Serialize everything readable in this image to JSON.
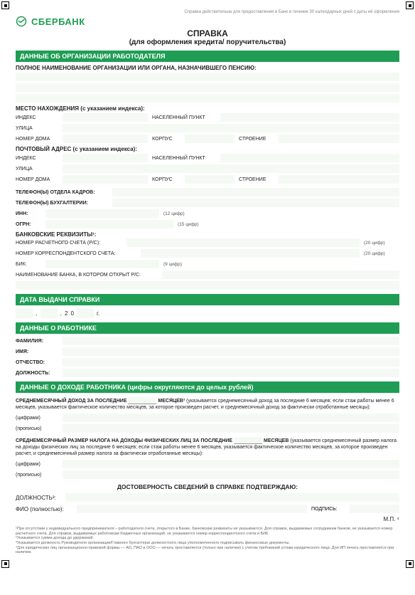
{
  "meta": {
    "top_note": "Справка действительна для предоставления в Банк в течение 30 календарных дней с даты её оформления"
  },
  "brand": {
    "name": "СБЕРБАНК"
  },
  "header": {
    "title": "СПРАВКА",
    "subtitle": "(для оформления кредита/ поручительства)"
  },
  "sections": {
    "org": "ДАННЫЕ ОБ ОРГАНИЗАЦИИ РАБОТОДАТЕЛЯ",
    "date": "ДАТА ВЫДАЧИ СПРАВКИ",
    "employee": "ДАННЫЕ О РАБОТНИКЕ",
    "income": "ДАННЫЕ О ДОХОДЕ РАБОТНИКА (цифры округляются до целых рублей)"
  },
  "org": {
    "full_name_label": "ПОЛНОЕ НАИМЕНОВАНИЕ ОРГАНИЗАЦИИ ИЛИ ОРГАНА, НАЗНАЧИВШЕГО ПЕНСИЮ:",
    "location_label": "МЕСТО НАХОЖДЕНИЯ (с указанием индекса):",
    "postal_label": "ПОЧТОВЫЙ АДРЕС (с указанием индекса):",
    "addr": {
      "index": "ИНДЕКС",
      "locality": "НАСЕЛЕННЫЙ ПУНКТ",
      "street": "УЛИЦА",
      "house": "НОМЕР ДОМА",
      "korpus": "КОРПУС",
      "building": "СТРОЕНИЕ"
    },
    "hr_phone": "ТЕЛЕФОН(Ы) ОТДЕЛА КАДРОВ:",
    "acc_phone": "ТЕЛЕФОН(Ы) БУХГАЛТЕРИИ:",
    "inn": "ИНН:",
    "inn_hint": "(12 цифр)",
    "ogrn": "ОГРН:",
    "ogrn_hint": "(15 цифр)",
    "bank_req": "БАНКОВСКИЕ РЕКВИЗИТЫ¹:",
    "rs": "НОМЕР РАСЧЕТНОГО СЧЕТА (Р/С):",
    "ks": "НОМЕР КОРРЕСПОНДЕНТСКОГО СЧЕТА:",
    "digits20": "(20 цифр)",
    "bik": "БИК:",
    "bik_hint": "(9 цифр)",
    "bank_name": "НАИМЕНОВАНИЕ БАНКА, В КОТОРОМ ОТКРЫТ Р/С:"
  },
  "date": {
    "two": "2",
    "zero": "0",
    "year_suffix": "г."
  },
  "employee": {
    "surname": "ФАМИЛИЯ:",
    "name": "ИМЯ:",
    "patronymic": "ОТЧЕСТВО:",
    "position": "ДОЛЖНОСТЬ:"
  },
  "income": {
    "avg_prefix": "СРЕДНЕМЕСЯЧНЫЙ ДОХОД ЗА ПОСЛЕДНИЕ",
    "avg_suffix": "МЕСЯЦЕВ²",
    "avg_hint": "(указывается среднемесячный доход за последние 6 месяцев; если стаж работы менее 6 месяцев, указывается фактическое количество месяцев, за которое произведен расчет, и среднемесячный доход за фактически отработанные месяцы):",
    "tax_prefix": "СРЕДНЕМЕСЯЧНЫЙ РАЗМЕР НАЛОГА НА ДОХОДЫ ФИЗИЧЕСКИХ ЛИЦ ЗА ПОСЛЕДНИЕ",
    "tax_suffix": "МЕСЯЦЕВ",
    "tax_hint": "(указывается среднемесячный размер налога на доходы физических лиц за последние 6 месяцев; если стаж работы менее 6 месяцев, указывается фактическое количество месяцев, за которое произведен расчет, и среднемесячный размер налога за фактически отработанные месяцы):",
    "digits": "(цифрами)",
    "words": "(прописью)"
  },
  "confirm": {
    "heading": "ДОСТОВЕРНОСТЬ СВЕДЕНИЙ В СПРАВКЕ ПОДТВЕРЖДАЮ:",
    "position": "ДОЛЖНОСТЬ³:",
    "fio": "ФИО (полностью):",
    "signature": "ПОДПИСЬ:",
    "mp": "М.П. ⁴"
  },
  "footnotes": [
    "¹При отсутствии у индивидуального предпринимателя – работодателя счета, открытого в Банке, банковские реквизиты не указываются. Для справок, выдаваемых сотрудникам банков, не указывается номер расчетного счета. Для справок, выдаваемых работникам бюджетных организаций, не указывается номер корреспондентского счета и БИК.",
    "²Указывается сумма дохода до удержаний.",
    "³Указывается должность Руководителя организации/Главного бухгалтера/ должностного лица уполномоченного подписывать финансовые документы.",
    "⁴Для юридических лиц организационно-правовой формы — АО, ПАО и ООО — печать проставляется (только при наличии) с учетом требований устава юридического лица. Для ИП печать проставляется при наличии."
  ]
}
